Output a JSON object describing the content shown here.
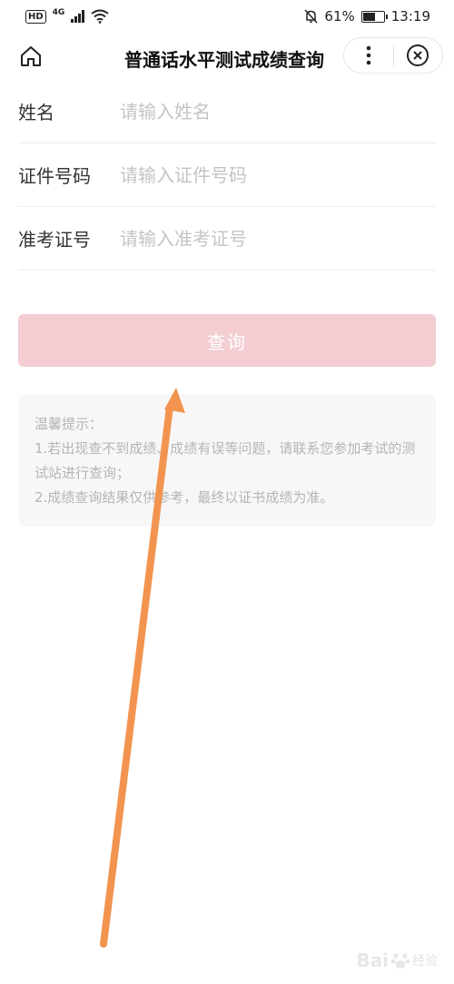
{
  "status_bar": {
    "hd_label": "HD",
    "network_label": "4G",
    "battery_percent": "61%",
    "battery_level": 0.61,
    "time": "13:19"
  },
  "nav": {
    "title": "普通话水平测试成绩查询",
    "home_icon": "home-icon",
    "more_icon": "more-dots-icon",
    "close_icon": "close-circle-icon"
  },
  "form": {
    "fields": [
      {
        "label": "姓名",
        "placeholder": "请输入姓名",
        "value": ""
      },
      {
        "label": "证件号码",
        "placeholder": "请输入证件号码",
        "value": ""
      },
      {
        "label": "准考证号",
        "placeholder": "请输入准考证号",
        "value": ""
      }
    ]
  },
  "query_button": {
    "label": "查询"
  },
  "tips": {
    "title": "温馨提示：",
    "line1": "1.若出现查不到成绩、成绩有误等问题，请联系您参加考试的测试站进行查询；",
    "line2": "2.成绩查询结果仅供参考，最终以证书成绩为准。"
  },
  "colors": {
    "button_bg": "#f3cdd1",
    "annotation_arrow": "#f29450",
    "tips_bg": "#f7f7f7"
  },
  "watermark": {
    "brand": "Bai",
    "sub": "经验"
  }
}
